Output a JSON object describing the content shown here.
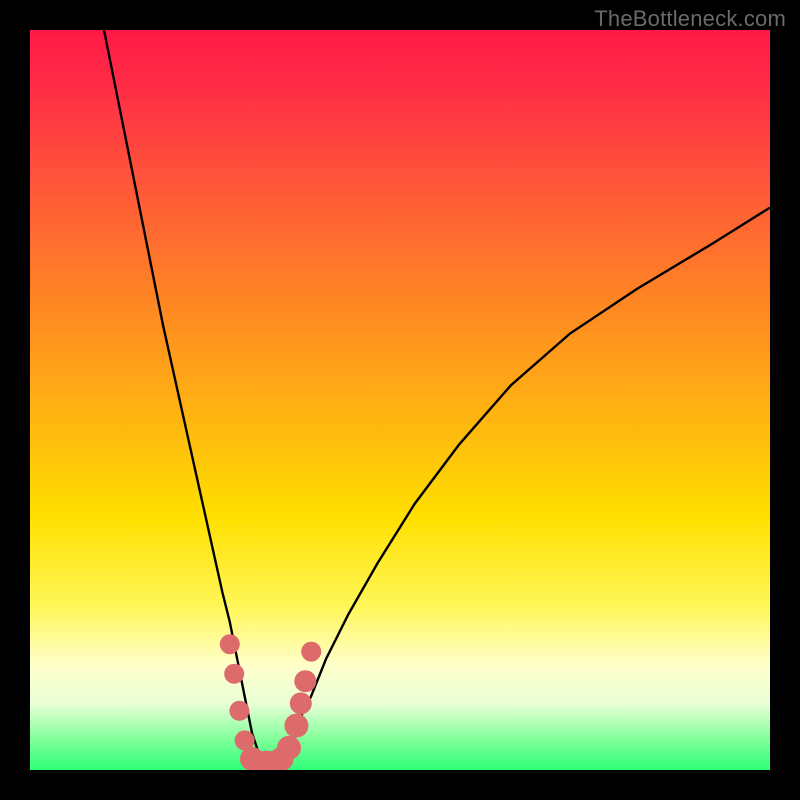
{
  "watermark": "TheBottleneck.com",
  "colors": {
    "frame": "#000000",
    "curve": "#000000",
    "marker_fill": "#de6b6b",
    "marker_stroke": "#de6b6b"
  },
  "chart_data": {
    "type": "line",
    "title": "",
    "xlabel": "",
    "ylabel": "",
    "xlim": [
      0,
      100
    ],
    "ylim": [
      0,
      100
    ],
    "grid": false,
    "series": [
      {
        "name": "bottleneck-curve",
        "x": [
          10,
          12,
          14,
          16,
          18,
          20,
          22,
          24,
          26,
          27,
          28,
          29,
          30,
          31,
          32,
          33,
          34,
          35,
          36,
          38,
          40,
          43,
          47,
          52,
          58,
          65,
          73,
          82,
          92,
          100
        ],
        "y": [
          100,
          90,
          80,
          70,
          60,
          51,
          42,
          33,
          24,
          20,
          15,
          10,
          5,
          2,
          0,
          0,
          1,
          3,
          6,
          10,
          15,
          21,
          28,
          36,
          44,
          52,
          59,
          65,
          71,
          76
        ]
      }
    ],
    "markers": [
      {
        "x": 27.0,
        "y": 17.0,
        "r": 10
      },
      {
        "x": 27.6,
        "y": 13.0,
        "r": 10
      },
      {
        "x": 28.3,
        "y": 8.0,
        "r": 10
      },
      {
        "x": 29.0,
        "y": 4.0,
        "r": 10
      },
      {
        "x": 30.0,
        "y": 1.5,
        "r": 12
      },
      {
        "x": 31.0,
        "y": 1.0,
        "r": 12
      },
      {
        "x": 32.0,
        "y": 1.0,
        "r": 12
      },
      {
        "x": 33.0,
        "y": 1.0,
        "r": 12
      },
      {
        "x": 34.0,
        "y": 1.5,
        "r": 12
      },
      {
        "x": 35.0,
        "y": 3.0,
        "r": 12
      },
      {
        "x": 36.0,
        "y": 6.0,
        "r": 12
      },
      {
        "x": 36.6,
        "y": 9.0,
        "r": 11
      },
      {
        "x": 37.2,
        "y": 12.0,
        "r": 11
      },
      {
        "x": 38.0,
        "y": 16.0,
        "r": 10
      }
    ]
  }
}
